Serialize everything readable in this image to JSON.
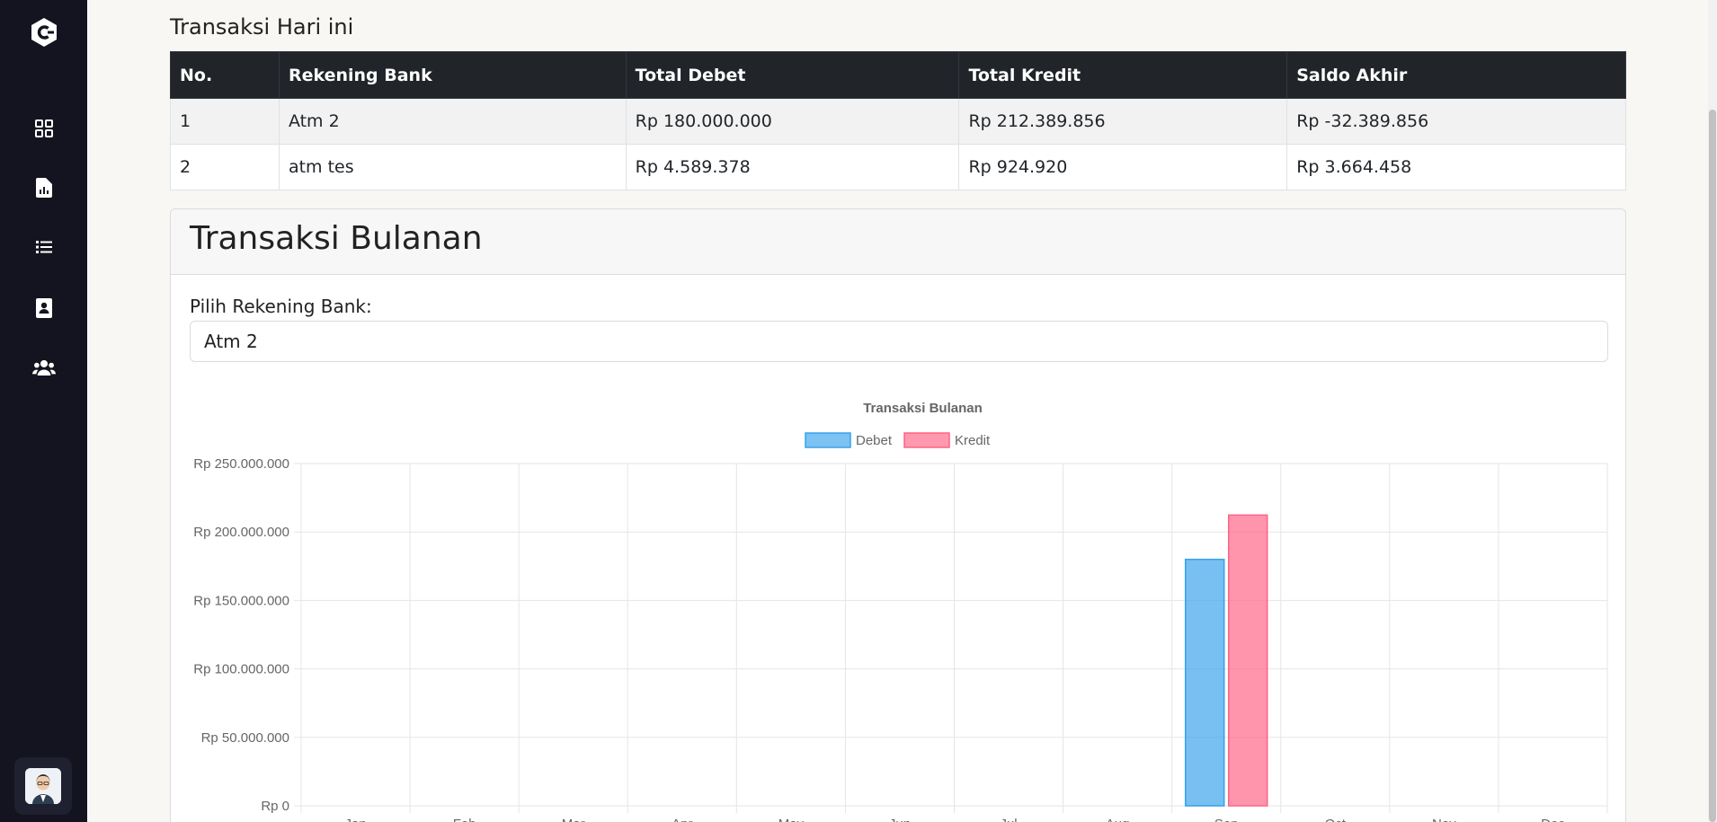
{
  "sidebar": {
    "logo": "c-logo-icon",
    "items": [
      {
        "icon": "dashboard-grid-icon"
      },
      {
        "icon": "report-file-icon"
      },
      {
        "icon": "list-icon"
      },
      {
        "icon": "contact-card-icon"
      },
      {
        "icon": "users-group-icon"
      }
    ],
    "avatar": "user-avatar"
  },
  "today": {
    "title": "Transaksi Hari ini",
    "columns": [
      "No.",
      "Rekening Bank",
      "Total Debet",
      "Total Kredit",
      "Saldo Akhir"
    ],
    "rows": [
      [
        "1",
        "Atm 2",
        "Rp 180.000.000",
        "Rp 212.389.856",
        "Rp -32.389.856"
      ],
      [
        "2",
        "atm tes",
        "Rp 4.589.378",
        "Rp 924.920",
        "Rp 3.664.458"
      ]
    ]
  },
  "monthly": {
    "title": "Transaksi Bulanan",
    "select_label": "Pilih Rekening Bank:",
    "selected_account": "Atm 2"
  },
  "chart_data": {
    "type": "bar",
    "title": "Transaksi Bulanan",
    "legend_position": "top",
    "grid": true,
    "categories": [
      "Jan",
      "Feb",
      "Mar",
      "Apr",
      "May",
      "Jun",
      "Jul",
      "Aug",
      "Sep",
      "Oct",
      "Nov",
      "Dec"
    ],
    "y_tick_labels": [
      "Rp 0",
      "Rp 50.000.000",
      "Rp 100.000.000",
      "Rp 150.000.000",
      "Rp 200.000.000",
      "Rp 250.000.000"
    ],
    "ylim": [
      0,
      250000000
    ],
    "series": [
      {
        "name": "Debet",
        "color": "#36a2eb",
        "values": [
          0,
          0,
          0,
          0,
          0,
          0,
          0,
          0,
          180000000,
          0,
          0,
          0
        ]
      },
      {
        "name": "Kredit",
        "color": "#ff6384",
        "values": [
          0,
          0,
          0,
          0,
          0,
          0,
          0,
          0,
          212389856,
          0,
          0,
          0
        ]
      }
    ]
  }
}
